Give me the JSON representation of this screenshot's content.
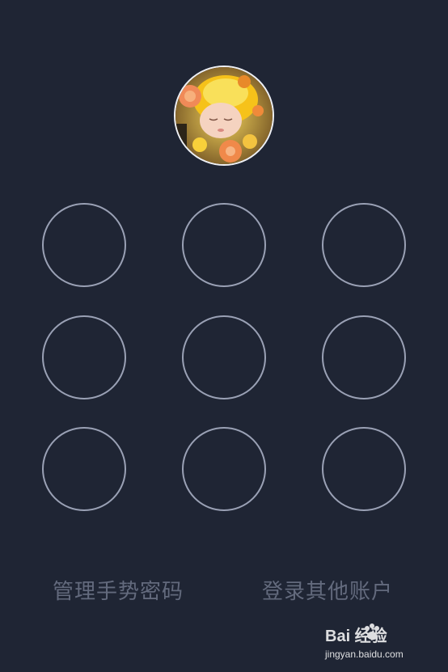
{
  "profile": {
    "avatar_alt": "头像"
  },
  "gesture": {
    "node_count": 9
  },
  "actions": {
    "manage_label": "管理手势密码",
    "switch_account_label": "登录其他账户"
  },
  "watermark": {
    "brand": "Bai 经验",
    "url": "jingyan.baidu.com"
  },
  "colors": {
    "background": "#1f2534",
    "ring": "#9aa1b5",
    "link_text": "#636a7d",
    "avatar_border": "#eef0f5"
  }
}
